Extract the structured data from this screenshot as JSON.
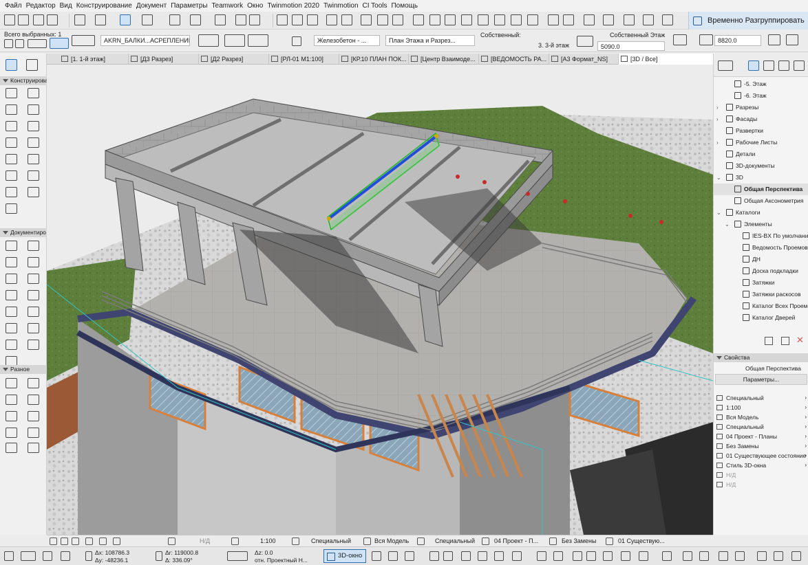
{
  "menu": [
    "Файл",
    "Редактор",
    "Вид",
    "Конструирование",
    "Документ",
    "Параметры",
    "Teamwork",
    "Окно",
    "Twinmotion 2020",
    "Twinmotion",
    "CI Tools",
    "Помощь"
  ],
  "toolbar": {
    "regroup_label": "Временно Разгруппировать"
  },
  "infobox": {
    "selected_label": "Всего выбранных: 1",
    "layer_value": "AKRN_БАЛКИ...АСРЕПЛЕНИЕ",
    "material_value": "Железобетон - ...",
    "view_value": "План Этажа и Разрез...",
    "own_label": "Собственный:",
    "own_value": "3. 3-й этаж",
    "story_label": "Собственный Этаж",
    "story_value": "5090.0",
    "height_value": "8820.0"
  },
  "tabs": [
    "[1. 1-й этаж]",
    "[Д3 Разрез]",
    "[Д2 Разрез]",
    "[РЛ-01 М1:100]",
    "[КР.10 ПЛАН ПОК...",
    "[Центр Взаимоде...",
    "[ВЕДОМОСТЬ РА...",
    "[А3 Формат_NS]",
    "[3D / Все]"
  ],
  "toolbox": {
    "construct": "Конструирова",
    "document": "Документиро",
    "misc": "Разное"
  },
  "navigator": [
    {
      "label": "-5. Этаж",
      "indent": 2
    },
    {
      "label": "-6. Этаж",
      "indent": 2
    },
    {
      "label": "Разрезы",
      "indent": 1,
      "arrow": "›"
    },
    {
      "label": "Фасады",
      "indent": 1,
      "arrow": "›"
    },
    {
      "label": "Развертки",
      "indent": 1
    },
    {
      "label": "Рабочие Листы",
      "indent": 1,
      "arrow": "›"
    },
    {
      "label": "Детали",
      "indent": 1
    },
    {
      "label": "3D-документы",
      "indent": 1
    },
    {
      "label": "3D",
      "indent": 1,
      "arrow": "⌄"
    },
    {
      "label": "Общая Перспектива",
      "indent": 2,
      "selected": true
    },
    {
      "label": "Общая Аксонометрия",
      "indent": 2
    },
    {
      "label": "Каталоги",
      "indent": 1,
      "arrow": "⌄"
    },
    {
      "label": "Элементы",
      "indent": 2,
      "arrow": "⌄"
    },
    {
      "label": "IES-BX По умолчанию",
      "indent": 3
    },
    {
      "label": "Ведомость Проемов",
      "indent": 3
    },
    {
      "label": "ДН",
      "indent": 3
    },
    {
      "label": "Доска подкладки",
      "indent": 3
    },
    {
      "label": "Затяжки",
      "indent": 3
    },
    {
      "label": "Затяжки раскосов",
      "indent": 3
    },
    {
      "label": "Каталог Всех Проемов",
      "indent": 3
    },
    {
      "label": "Каталог Дверей",
      "indent": 3
    }
  ],
  "properties": {
    "header": "Свойства",
    "view_name": "Общая Перспектива",
    "params_button": "Параметры...",
    "rows": [
      {
        "label": "Специальный"
      },
      {
        "label": "1:100"
      },
      {
        "label": "Вся Модель"
      },
      {
        "label": "Специальный"
      },
      {
        "label": "04 Проект - Планы"
      },
      {
        "label": "Без Замены"
      },
      {
        "label": "01 Существующее состояние"
      },
      {
        "label": "Стиль 3D-окна"
      },
      {
        "label": "Н/Д",
        "dim": true
      },
      {
        "label": "Н/Д",
        "dim": true
      }
    ]
  },
  "statusbar": {
    "nd": "Н/Д",
    "scale": "1:100",
    "layer_combo": "Специальный",
    "model": "Вся Модель",
    "pen": "Специальный",
    "view_combo": "04 Проект - П...",
    "override": "Без Замены",
    "renovation": "01 Существую..."
  },
  "coords": {
    "dx": "Δx: 108786.3",
    "dy": "Δy: -48236.1",
    "dr": "Δr: 119000.8",
    "da": "Δ: 336.09°",
    "dz": "Δz: 0.0",
    "rel": "отн. Проектный Н..."
  },
  "bottom": {
    "window_3d": "3D-окно"
  },
  "colors": {
    "accent": "#2d6fb1",
    "selection_blue": "#1f4fd6",
    "selection_green": "#19b81f",
    "grass": "#5c7f3a",
    "concrete": "#a9a9a9"
  }
}
